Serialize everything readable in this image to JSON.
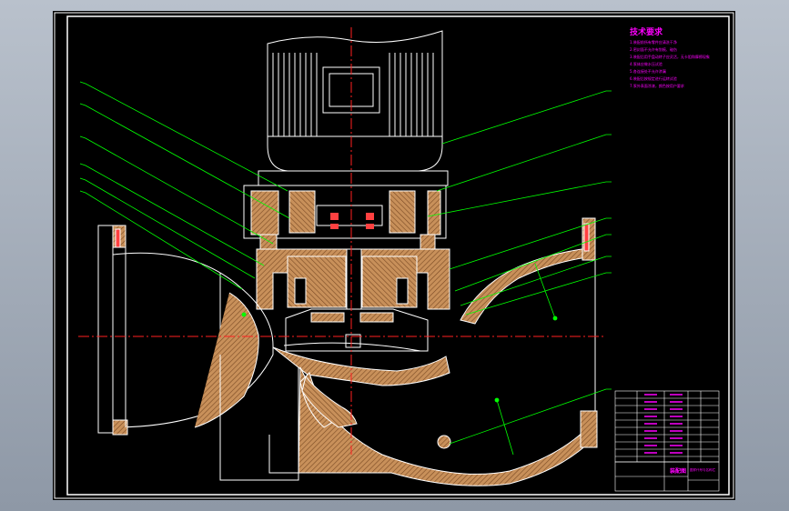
{
  "drawing": {
    "technical_requirements": {
      "title": "技术要求",
      "items": [
        "1.装配前所有零件应清洗干净",
        "2.密封面不允许有划痕、碰伤",
        "3.装配后用手盘动转子应灵活，无卡阻和摩擦现象",
        "4.泵体应做水压试验",
        "5.各连接处不允许渗漏",
        "6.装配后按规定进行运转试验",
        "7.泵外表面涂漆，颜色按用户要求"
      ]
    },
    "title_block": {
      "drawing_name": "装配图",
      "note": "图样代号与名称栏"
    },
    "colors": {
      "background": "#000000",
      "outline": "#ffffff",
      "leader": "#00ff00",
      "centerline": "#ff2020",
      "section_fill": "#c8905a",
      "text": "#ff00ff",
      "motor": "#ffffff",
      "seal": "#ff4040"
    }
  }
}
